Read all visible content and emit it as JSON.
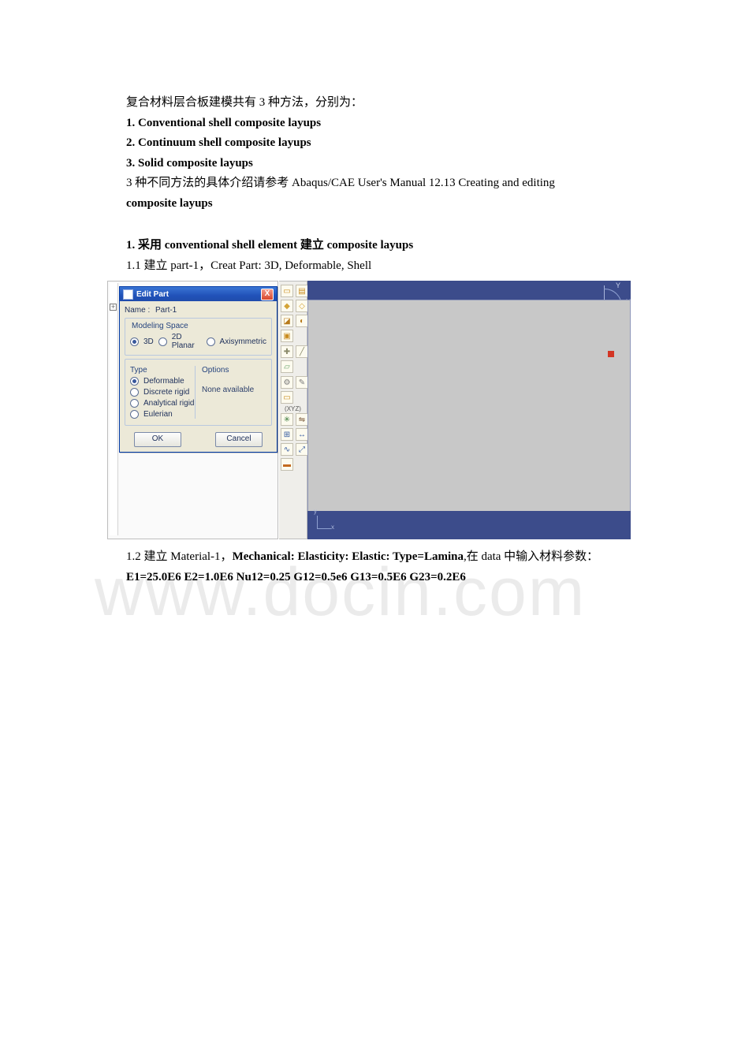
{
  "text": {
    "intro": "复合材料层合板建模共有 3 种方法，分别为：",
    "m1": "1. Conventional shell composite layups",
    "m2": "2. Continuum shell composite layups",
    "m3": "3. Solid composite layups",
    "ref_a": "3 种不同方法的具体介绍请参考 Abaqus/CAE User's Manual   12.13 Creating and editing",
    "ref_b": "composite layups",
    "sec1": "1.  采用 conventional shell element  建立 composite layups",
    "sec11": "1.1 建立 part-1，Creat Part: 3D,    Deformable,    Shell",
    "sec12_a": "1.2  建立 Material-1，",
    "sec12_b": "Mechanical: Elasticity: Elastic: Type=Lamina",
    "sec12_c": ",在 data 中输入材料参数：",
    "params": "E1=25.0E6 E2=1.0E6 Nu12=0.25 G12=0.5e6 G13=0.5E6 G23=0.2E6"
  },
  "dialog": {
    "title": "Edit Part",
    "close": "X",
    "name_label": "Name :",
    "name_value": "Part-1",
    "modeling_space": "Modeling Space",
    "opt_3d": "3D",
    "opt_2d": "2D Planar",
    "opt_axi": "Axisymmetric",
    "type": "Type",
    "options": "Options",
    "deformable": "Deformable",
    "discrete": "Discrete rigid",
    "analytical": "Analytical rigid",
    "eulerian": "Eulerian",
    "none": "None available",
    "ok": "OK",
    "cancel": "Cancel"
  },
  "toolbox": {
    "xyz": "(XYZ)"
  },
  "axes": {
    "x": "X",
    "y": "Y",
    "x2": "x",
    "y2": "y"
  },
  "watermark": "www.docin.com"
}
